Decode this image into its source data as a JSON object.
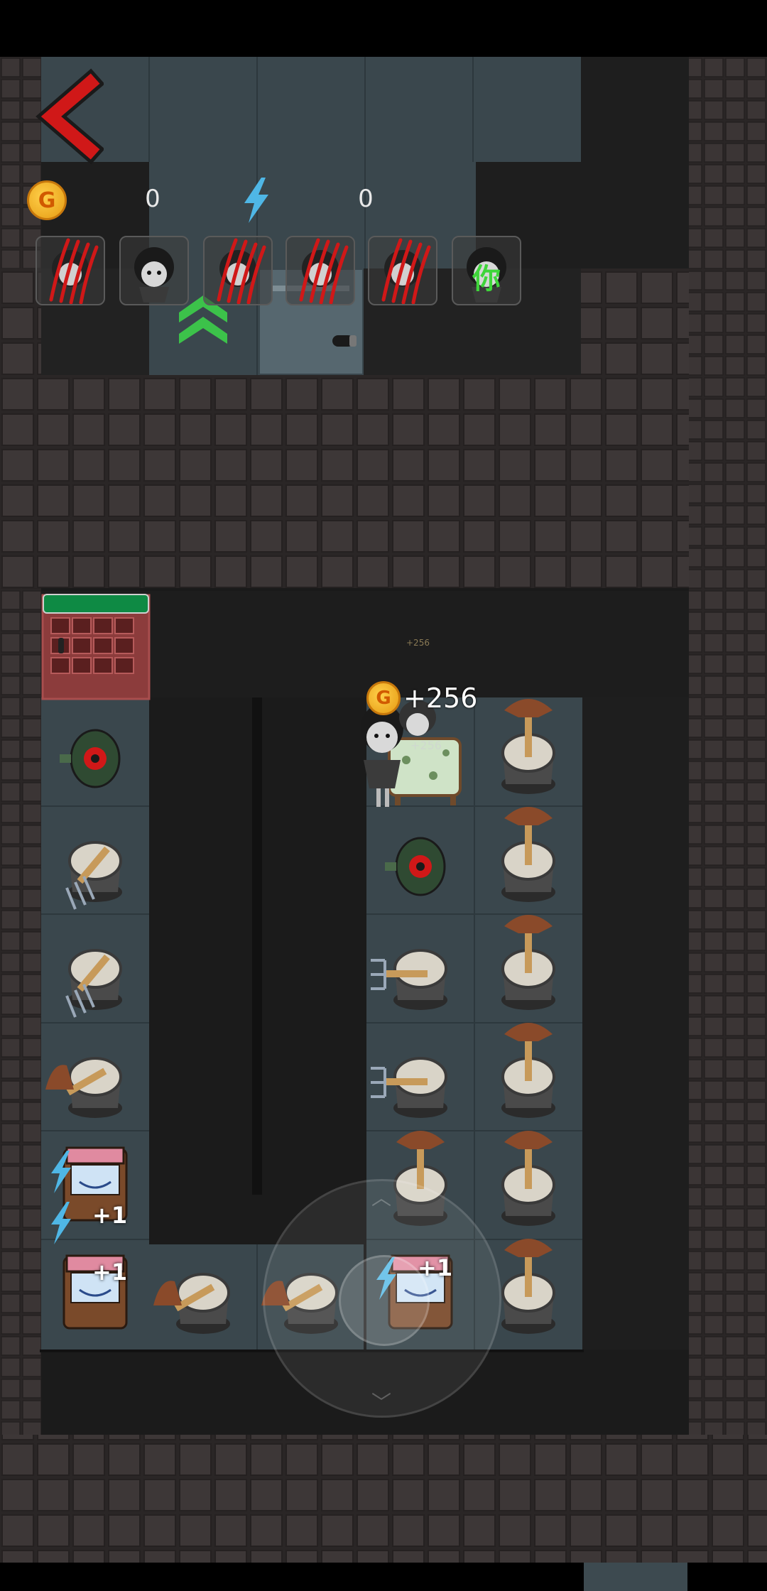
{
  "hud": {
    "coins": "0",
    "energy": "0",
    "coin_symbol": "G"
  },
  "party": [
    {
      "slot": 1,
      "state": "slashed"
    },
    {
      "slot": 2,
      "state": "alive"
    },
    {
      "slot": 3,
      "state": "slashed"
    },
    {
      "slot": 4,
      "state": "slashed"
    },
    {
      "slot": 5,
      "state": "slashed"
    },
    {
      "slot": 6,
      "state": "you",
      "label": "你"
    }
  ],
  "popups": {
    "coin_gain": "+256",
    "coin_gain_small": "+256",
    "coin_gain_tiny": "+256",
    "energy_bonus_1": "+1",
    "energy_bonus_2": "+1",
    "energy_bonus_3": "+1"
  },
  "colors": {
    "floor_tile": "#3a474d",
    "wall": "#2b2b2b",
    "brick": "#3b3535",
    "door_green": "#0e8a44",
    "accent_red": "#d01818",
    "upgrade_green": "#3cc24a",
    "energy_blue": "#4fb7e6"
  },
  "icons": {
    "back": "back-arrow-icon",
    "coin": "coin-icon",
    "energy": "lightning-icon",
    "upgrade": "double-chevron-up-icon",
    "turret": "broom-bucket-turret-icon",
    "pitchfork": "pitchfork-bucket-turret-icon",
    "generator": "green-generator-icon",
    "energy_machine": "arcade-energy-machine-icon",
    "bed": "bed-icon",
    "door": "red-door-icon"
  }
}
